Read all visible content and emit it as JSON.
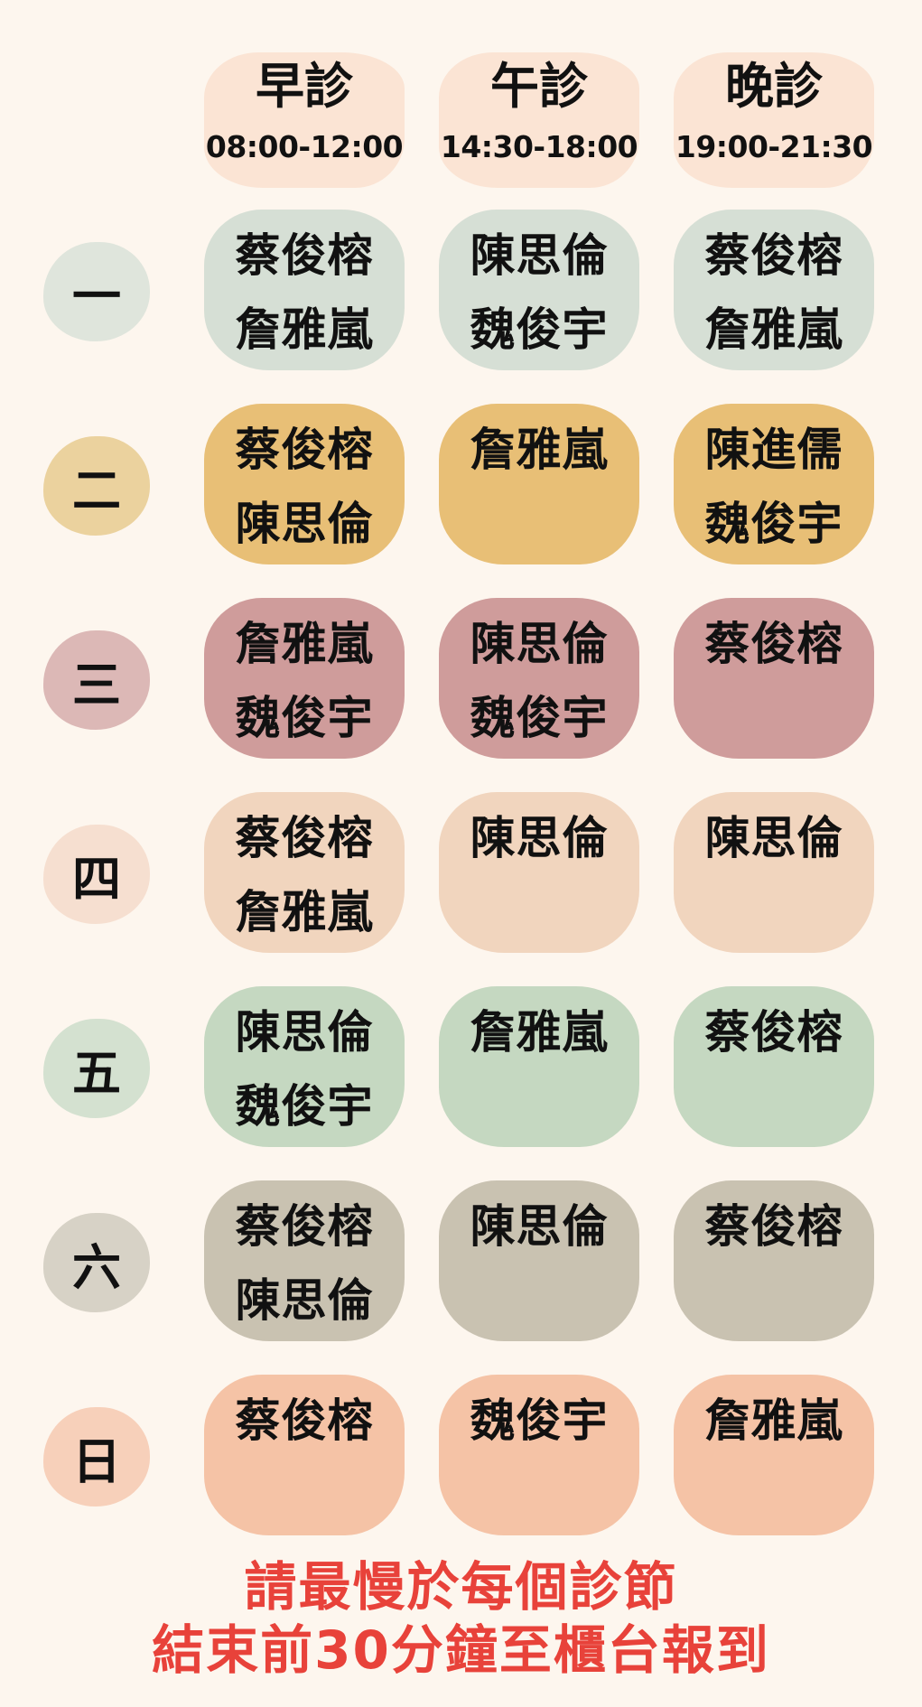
{
  "shifts": [
    {
      "name": "早診",
      "time": "08:00-12:00"
    },
    {
      "name": "午診",
      "time": "14:30-18:00"
    },
    {
      "name": "晚診",
      "time": "19:00-21:30"
    }
  ],
  "days": [
    {
      "label": "一",
      "color": "#dfe5dc",
      "cell_color": "#d6dfd5",
      "slots": [
        [
          "蔡俊榕",
          "詹雅嵐"
        ],
        [
          "陳思倫",
          "魏俊宇"
        ],
        [
          "蔡俊榕",
          "詹雅嵐"
        ]
      ]
    },
    {
      "label": "二",
      "color": "#ebd29e",
      "cell_color": "#e8bf76",
      "slots": [
        [
          "蔡俊榕",
          "陳思倫"
        ],
        [
          "詹雅嵐"
        ],
        [
          "陳進儒",
          "魏俊宇"
        ]
      ]
    },
    {
      "label": "三",
      "color": "#dcb8b6",
      "cell_color": "#cf9c9b",
      "slots": [
        [
          "詹雅嵐",
          "魏俊宇"
        ],
        [
          "陳思倫",
          "魏俊宇"
        ],
        [
          "蔡俊榕"
        ]
      ]
    },
    {
      "label": "四",
      "color": "#f6dfd0",
      "cell_color": "#f1d5be",
      "slots": [
        [
          "蔡俊榕",
          "詹雅嵐"
        ],
        [
          "陳思倫"
        ],
        [
          "陳思倫"
        ]
      ]
    },
    {
      "label": "五",
      "color": "#d4e1d0",
      "cell_color": "#c5d8c1",
      "slots": [
        [
          "陳思倫",
          "魏俊宇"
        ],
        [
          "詹雅嵐"
        ],
        [
          "蔡俊榕"
        ]
      ]
    },
    {
      "label": "六",
      "color": "#d7d2c6",
      "cell_color": "#c9c2b1",
      "slots": [
        [
          "蔡俊榕",
          "陳思倫"
        ],
        [
          "陳思倫"
        ],
        [
          "蔡俊榕"
        ]
      ]
    },
    {
      "label": "日",
      "color": "#f7d0ba",
      "cell_color": "#f5c3a6",
      "slots": [
        [
          "蔡俊榕"
        ],
        [
          "魏俊宇"
        ],
        [
          "詹雅嵐"
        ]
      ]
    }
  ],
  "note": {
    "line1": "請最慢於每個診節",
    "line2": "結束前30分鐘至櫃台報到",
    "color": "#e8423a"
  }
}
